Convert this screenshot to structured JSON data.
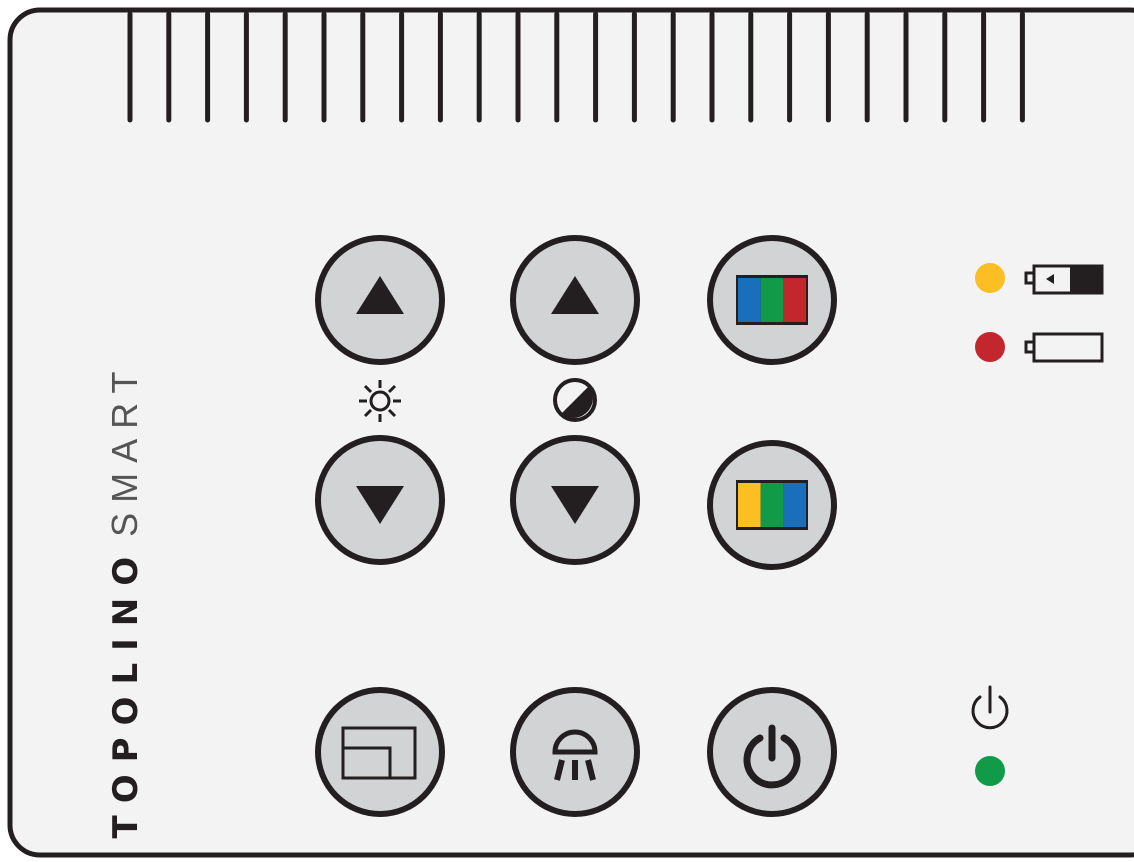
{
  "brand": {
    "name_bold": "TOPOLINO",
    "name_light": "SMART"
  },
  "controls": {
    "brightness": {
      "up": "brightness-up",
      "down": "brightness-down",
      "icon": "sun-icon"
    },
    "contrast": {
      "up": "contrast-up",
      "down": "contrast-down",
      "icon": "contrast-icon"
    },
    "color_mode_1": {
      "icon": "color-bars-blue-green-red",
      "colors": [
        "#1a6fba",
        "#119a48",
        "#c1272d"
      ]
    },
    "color_mode_2": {
      "icon": "color-bars-yellow-green-blue",
      "colors": [
        "#fbbf24",
        "#119a48",
        "#1a6fba"
      ]
    },
    "window": {
      "icon": "window-icon"
    },
    "light": {
      "icon": "lamp-icon"
    },
    "power": {
      "icon": "power-icon"
    }
  },
  "indicators": {
    "battery_charging": {
      "led_color": "#fbbf24",
      "icon": "battery-charging-icon"
    },
    "battery_low": {
      "led_color": "#c1272d",
      "icon": "battery-empty-icon"
    },
    "power": {
      "led_color": "#119a48",
      "icon": "power-icon"
    }
  },
  "colors": {
    "button_fill": "#d1d3d4",
    "stroke": "#231f20",
    "panel": "#f3f3f4"
  }
}
